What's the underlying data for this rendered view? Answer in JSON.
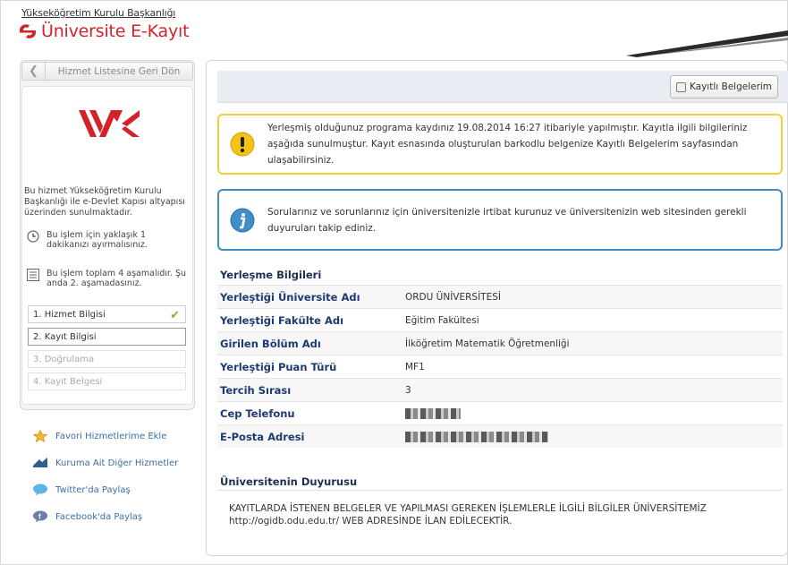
{
  "header": {
    "ministry_link": "Yükseköğretim Kurulu Başkanlığı",
    "app_title": "Üniversite E-Kayıt",
    "brand_color": "#d2232a"
  },
  "sidebar": {
    "back_button": "Hizmet Listesine Geri Dön",
    "description": "Bu hizmet Yükseköğretim Kurulu Başkanlığı ile e-Devlet Kapısı altyapısı üzerinden sunulmaktadır.",
    "duration_info": "Bu işlem için yaklaşık 1 dakikanızı ayırmalısınız.",
    "steps_info": "Bu işlem toplam 4 aşamalıdır. Şu anda 2. aşamadasınız.",
    "steps": [
      {
        "label": "1. Hizmet Bilgisi",
        "state": "done"
      },
      {
        "label": "2. Kayıt Bilgisi",
        "state": "active"
      },
      {
        "label": "3. Doğrulama",
        "state": "pending"
      },
      {
        "label": "4. Kayıt Belgesi",
        "state": "pending"
      }
    ],
    "links": [
      {
        "label": "Favori Hizmetlerime Ekle",
        "icon": "star-icon"
      },
      {
        "label": "Kuruma Ait Diğer Hizmetler",
        "icon": "arrow-icon"
      },
      {
        "label": "Twitter'da Paylaş",
        "icon": "twitter-icon"
      },
      {
        "label": "Facebook'da Paylaş",
        "icon": "facebook-icon"
      }
    ]
  },
  "toolbar": {
    "docs_button": "Kayıtlı Belgelerim"
  },
  "alerts": {
    "warning": "Yerleşmiş olduğunuz programa kaydınız 19.08.2014 16:27 itibariyle yapılmıştır. Kayıtla ilgili bilgileriniz aşağıda sunulmuştur. Kayıt esnasında oluşturulan barkodlu belgenize Kayıtlı Belgelerim sayfasından ulaşabilirsiniz.",
    "info": "Sorularınız ve sorunlarınız için üniversitenizle irtibat kurunuz ve üniversitenizin web sitesinden gerekli duyuruları takip ediniz."
  },
  "placement": {
    "section_title": "Yerleşme Bilgileri",
    "rows": [
      {
        "label": "Yerleştiği Üniversite Adı",
        "value": "ORDU ÜNİVERSİTESİ"
      },
      {
        "label": "Yerleştiği Fakülte Adı",
        "value": "Eğitim Fakültesi"
      },
      {
        "label": "Girilen Bölüm Adı",
        "value": "İlköğretim Matematik Öğretmenliği"
      },
      {
        "label": "Yerleştiği Puan Türü",
        "value": "MF1"
      },
      {
        "label": "Tercih Sırası",
        "value": "3"
      },
      {
        "label": "Cep Telefonu",
        "value": ""
      },
      {
        "label": "E-Posta Adresi",
        "value": ""
      }
    ]
  },
  "announcement": {
    "title": "Üniversitenin Duyurusu",
    "text": "KAYITLARDA İSTENEN BELGELER VE YAPILMASI GEREKEN İŞLEMLERLE İLGİLİ BİLGİLER ÜNİVERSİTEMİZ http://ogidb.odu.edu.tr/ WEB ADRESİNDE İLAN EDİLECEKTİR."
  }
}
